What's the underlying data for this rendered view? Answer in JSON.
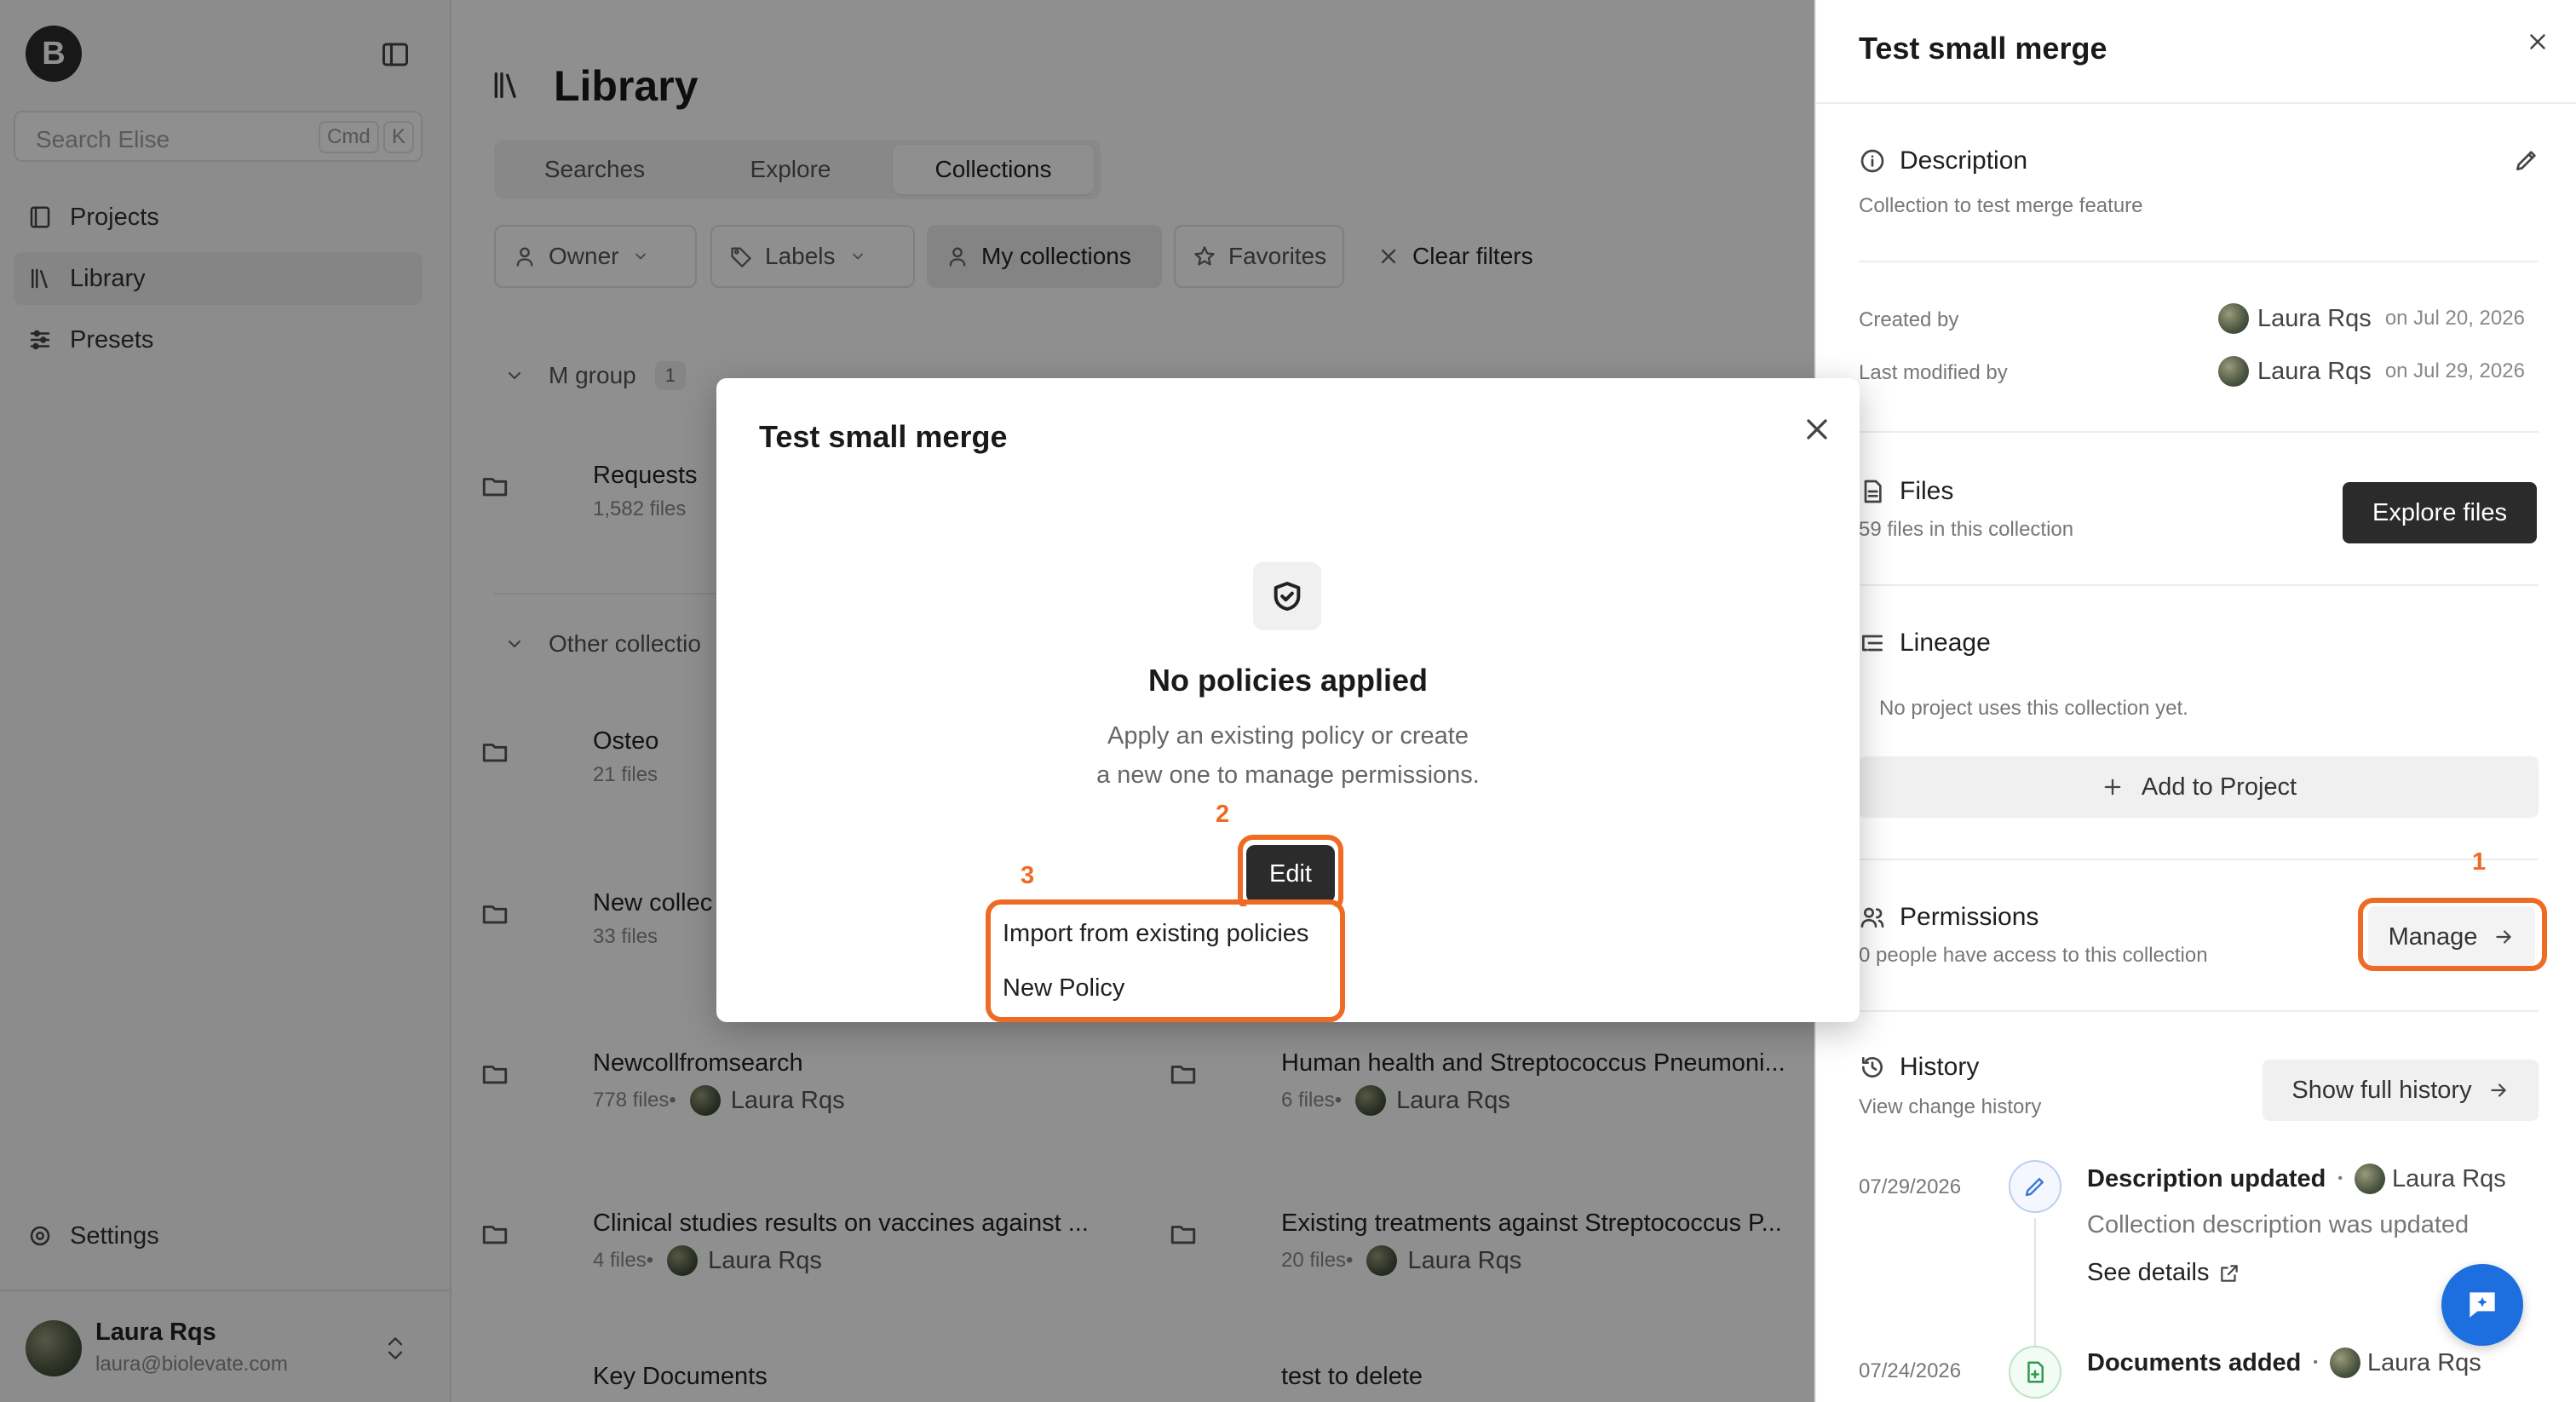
{
  "sidebar": {
    "logo": "B",
    "search_placeholder": "Search Elise",
    "shortcut_cmd": "Cmd",
    "shortcut_k": "K",
    "items": [
      {
        "label": "Projects"
      },
      {
        "label": "Library"
      },
      {
        "label": "Presets"
      }
    ],
    "settings": "Settings",
    "user_name": "Laura Rqs",
    "user_email": "laura@biolevate.com"
  },
  "main": {
    "title": "Library",
    "tabs": [
      "Searches",
      "Explore",
      "Collections"
    ],
    "filters": {
      "owner": "Owner",
      "labels": "Labels",
      "my_collections": "My collections",
      "favorites": "Favorites",
      "clear": "Clear filters"
    },
    "group1": {
      "name": "M group",
      "count": "1"
    },
    "group2": {
      "name": "Other collectio"
    },
    "items": [
      {
        "name": "Requests",
        "files": "1,582 files",
        "owner": ""
      },
      {
        "name": "Osteo",
        "files": "21 files",
        "owner": ""
      },
      {
        "name": "New collec",
        "files": "33 files",
        "owner": ""
      },
      {
        "name": "Newcollfromsearch",
        "files": "778 files",
        "owner": "Laura Rqs"
      },
      {
        "name": "Human health and Streptococcus Pneumoni...",
        "files": "6 files",
        "owner": "Laura Rqs"
      },
      {
        "name": "Clinical studies results on vaccines against ...",
        "files": "4 files",
        "owner": "Laura Rqs"
      },
      {
        "name": "Existing treatments against Streptococcus P...",
        "files": "20 files",
        "owner": "Laura Rqs"
      },
      {
        "name": "Key Documents",
        "files": "",
        "owner": ""
      },
      {
        "name": "test to delete",
        "files": "",
        "owner": ""
      }
    ]
  },
  "panel": {
    "title": "Test small merge",
    "description_label": "Description",
    "description_text": "Collection to test merge feature",
    "created_by_label": "Created by",
    "created_by_user": "Laura Rqs",
    "created_on": "on Jul 20, 2026",
    "modified_by_label": "Last modified by",
    "modified_by_user": "Laura Rqs",
    "modified_on": "on Jul 29, 2026",
    "files_label": "Files",
    "files_sub": "59 files in this collection",
    "explore_files": "Explore files",
    "lineage_label": "Lineage",
    "lineage_sub": "No project uses this collection yet.",
    "add_to_project": "Add to Project",
    "permissions_label": "Permissions",
    "permissions_sub": "0 people have access to this collection",
    "manage": "Manage",
    "marker_1": "1",
    "history_label": "History",
    "history_sub": "View change history",
    "show_full_history": "Show full history",
    "events": [
      {
        "date": "07/29/2026",
        "title": "Description updated",
        "user": "Laura Rqs",
        "detail": "Collection description was updated",
        "link": "See details"
      },
      {
        "date": "07/24/2026",
        "title": "Documents added",
        "user": "Laura Rqs"
      }
    ]
  },
  "modal": {
    "title": "Test small merge",
    "empty_title": "No policies applied",
    "empty_line1": "Apply an existing policy or create",
    "empty_line2": "a new one to manage permissions.",
    "edit": "Edit",
    "marker_2": "2",
    "marker_3": "3",
    "menu": [
      "Import from existing policies",
      "New Policy"
    ]
  },
  "colors": {
    "accent_highlight": "#ef6a22",
    "fab": "#1d6fe0",
    "dark_button": "#2b2b2b"
  }
}
